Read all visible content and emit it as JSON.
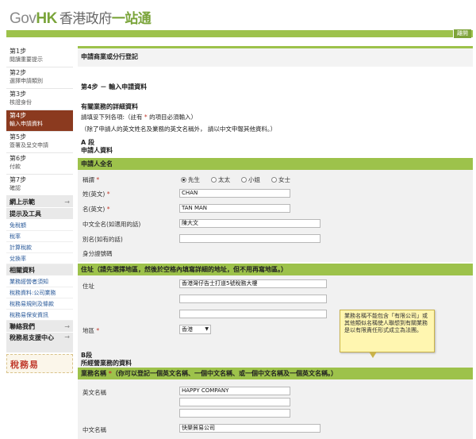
{
  "header": {
    "logo_gov": "Gov",
    "logo_hk": "HK",
    "logo_zh": "香港政府",
    "logo_zh2": "一站通",
    "logout": "離開"
  },
  "sidebar": {
    "steps": [
      {
        "title": "第1步",
        "desc": "閱讀重要提示"
      },
      {
        "title": "第2步",
        "desc": "選擇申請類別"
      },
      {
        "title": "第3步",
        "desc": "核證身份"
      },
      {
        "title": "第4步",
        "desc": "輸入申請資料"
      },
      {
        "title": "第5步",
        "desc": "簽署及呈交申請"
      },
      {
        "title": "第6步",
        "desc": "付款"
      },
      {
        "title": "第7步",
        "desc": "確認"
      }
    ],
    "guide": "網上示範",
    "tools": "提示及工具",
    "tool_links": [
      "免稅額",
      "稅率",
      "計算稅款",
      "兌換率"
    ],
    "related": "相關資料",
    "related_links": [
      "業務經營者須知",
      "稅務資料:公司業務",
      "稅務易規則及條款",
      "稅務易保安資訊"
    ],
    "contact": "聯絡我們",
    "support": "稅務易支援中心",
    "brand": "稅務易"
  },
  "main": {
    "title": "申請商業或分行登記",
    "step_title": "第4步 － 輸入申請資料",
    "subtitle": "有關業務的詳細資料",
    "inst1_a": "請填妥下列各項:（註有",
    "inst1_star": "*",
    "inst1_b": "的項目必須輸入）",
    "inst2": "（除了申請人的英文姓名及業務的英文名稱外， 請以中文申報其他資料。）",
    "secA_1": "A 段",
    "secA_2": "申請人資料",
    "applicant_bar": "申請人全名",
    "title_label": "稱謂",
    "titles": [
      "先生",
      "太太",
      "小姐",
      "女士"
    ],
    "surname_label": "姓(英文)",
    "surname": "CHAN",
    "given_label": "名(英文)",
    "given": "TAN MAN",
    "cname_label": "中文全名(如適用的話)",
    "cname": "陳大文",
    "alias_label": "別名(如有的話)",
    "alias": "",
    "id_label": "身分證號碼",
    "address_bar": "住址",
    "address_note": "（請先選擇地區，然後於空格內填寫詳細的地址，但不用再寫地區。）",
    "addr_label": "住址",
    "addr1": "香港灣仔告士打道5號稅務大樓",
    "district_label": "地區",
    "district": "香港",
    "secB_1": "B段",
    "secB_2": "所經營業務的資料",
    "bizname_bar": "業務名稱",
    "bizname_note": "（你可以登記一個英文名稱、一個中文名稱、或一個中文名稱及一個英文名稱。）",
    "en_label": "英文名稱",
    "en_name": "HAPPY COMPANY",
    "zh_label": "中文名稱",
    "zh_name": "快樂貿易公司",
    "req_star": "*"
  },
  "tooltip": "業務名稱不能包含「有限公司」或其他類似名稱使人聯想到有關業務是以有限責任形式成立為法團。"
}
